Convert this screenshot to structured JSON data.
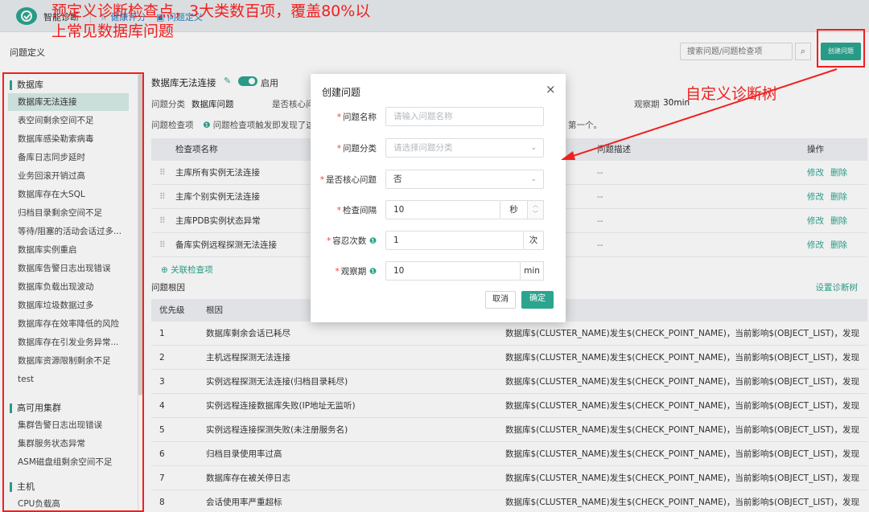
{
  "top": {
    "brand": "智能诊断",
    "nav1": "健康评分",
    "nav2": "问题定义"
  },
  "page": {
    "title": "问题定义",
    "search_placeholder": "搜索问题/问题检查项",
    "create_btn": "创建问题"
  },
  "annotations": {
    "a1": "预定义诊断检查点，3大类数百项，覆盖80%以上常见数据库问题",
    "a2": "自定义诊断树"
  },
  "sidebar": {
    "groups": [
      {
        "label": "数据库",
        "items": [
          "数据库无法连接",
          "表空间剩余空间不足",
          "数据库感染勒索病毒",
          "备库日志同步延时",
          "业务回滚开销过高",
          "数据库存在大SQL",
          "归档目录剩余空间不足",
          "等待/阻塞的活动会话过多...",
          "数据库实例重启",
          "数据库告警日志出现错误",
          "数据库负载出现波动",
          "数据库垃圾数据过多",
          "数据库存在效率降低的风险",
          "数据库存在引发业务异常...",
          "数据库资源限制剩余不足",
          "test"
        ]
      },
      {
        "label": "高可用集群",
        "items": [
          "集群告警日志出现错误",
          "集群服务状态异常",
          "ASM磁盘组剩余空间不足"
        ]
      },
      {
        "label": "主机",
        "items": [
          "CPU负载高"
        ]
      }
    ]
  },
  "detail": {
    "title": "数据库无法连接",
    "toggle_label": "启用",
    "cat_label": "问题分类",
    "cat_value": "数据库问题",
    "core_label": "是否核心问",
    "obs_label": "观察期",
    "obs_value": "30min",
    "check_label": "问题检查项",
    "check_hint": "问题检查项触发即发现了这",
    "check_hint_tail": "第一个。",
    "cols": {
      "name": "检查项名称",
      "desc": "问题描述",
      "ops": "操作"
    },
    "checks": [
      {
        "name": "主库所有实例无法连接",
        "desc": "--"
      },
      {
        "name": "主库个别实例无法连接",
        "desc": "--"
      },
      {
        "name": "主库PDB实例状态异常",
        "desc": "--"
      },
      {
        "name": "备库实例远程探测无法连接",
        "desc": "--"
      }
    ],
    "edit": "修改",
    "delete": "删除",
    "add_link": "关联检查项",
    "rc_label": "问题根因",
    "set_tree": "设置诊断树",
    "rc_cols": {
      "prio": "优先级",
      "cause": "根因"
    },
    "causes": [
      {
        "p": "1",
        "c": "数据库剩余会话已耗尽",
        "d": "数据库$(CLUSTER_NAME)发生$(CHECK_POINT_NAME)，当前影响$(OBJECT_LIST)，发现$(PRO..."
      },
      {
        "p": "2",
        "c": "主机远程探测无法连接",
        "d": "数据库$(CLUSTER_NAME)发生$(CHECK_POINT_NAME)，当前影响$(OBJECT_LIST)，发现$(PRO..."
      },
      {
        "p": "3",
        "c": "实例远程探测无法连接(归档目录耗尽)",
        "d": "数据库$(CLUSTER_NAME)发生$(CHECK_POINT_NAME)，当前影响$(OBJECT_LIST)，发现$(PRO..."
      },
      {
        "p": "4",
        "c": "实例远程连接数据库失败(IP地址无监听)",
        "d": "数据库$(CLUSTER_NAME)发生$(CHECK_POINT_NAME)，当前影响$(OBJECT_LIST)，发现$(PRO..."
      },
      {
        "p": "5",
        "c": "实例远程连接探测失败(未注册服务名)",
        "d": "数据库$(CLUSTER_NAME)发生$(CHECK_POINT_NAME)，当前影响$(OBJECT_LIST)，发现$(PRO..."
      },
      {
        "p": "6",
        "c": "归档目录使用率过高",
        "d": "数据库$(CLUSTER_NAME)发生$(CHECK_POINT_NAME)，当前影响$(OBJECT_LIST)，发现$(PRO..."
      },
      {
        "p": "7",
        "c": "数据库存在被关停日志",
        "d": "数据库$(CLUSTER_NAME)发生$(CHECK_POINT_NAME)，当前影响$(OBJECT_LIST)，发现$(PRO..."
      },
      {
        "p": "8",
        "c": "会话使用率严重超标",
        "d": "数据库$(CLUSTER_NAME)发生$(CHECK_POINT_NAME)，当前影响$(OBJECT_LIST)，发现$(PRO..."
      }
    ]
  },
  "modal": {
    "title": "创建问题",
    "close": "×",
    "name_label": "问题名称",
    "name_ph": "请输入问题名称",
    "cat_label": "问题分类",
    "cat_ph": "请选择问题分类",
    "core_label": "是否核心问题",
    "core_value": "否",
    "interval_label": "检查间隔",
    "interval_value": "10",
    "interval_unit": "秒",
    "tolerance_label": "容忍次数",
    "tolerance_value": "1",
    "tolerance_unit": "次",
    "obs_label": "观察期",
    "obs_value": "10",
    "obs_unit": "min",
    "cancel": "取消",
    "ok": "确定"
  },
  "colors": {
    "accent": "#2ba58f",
    "annotation": "#f02020"
  }
}
